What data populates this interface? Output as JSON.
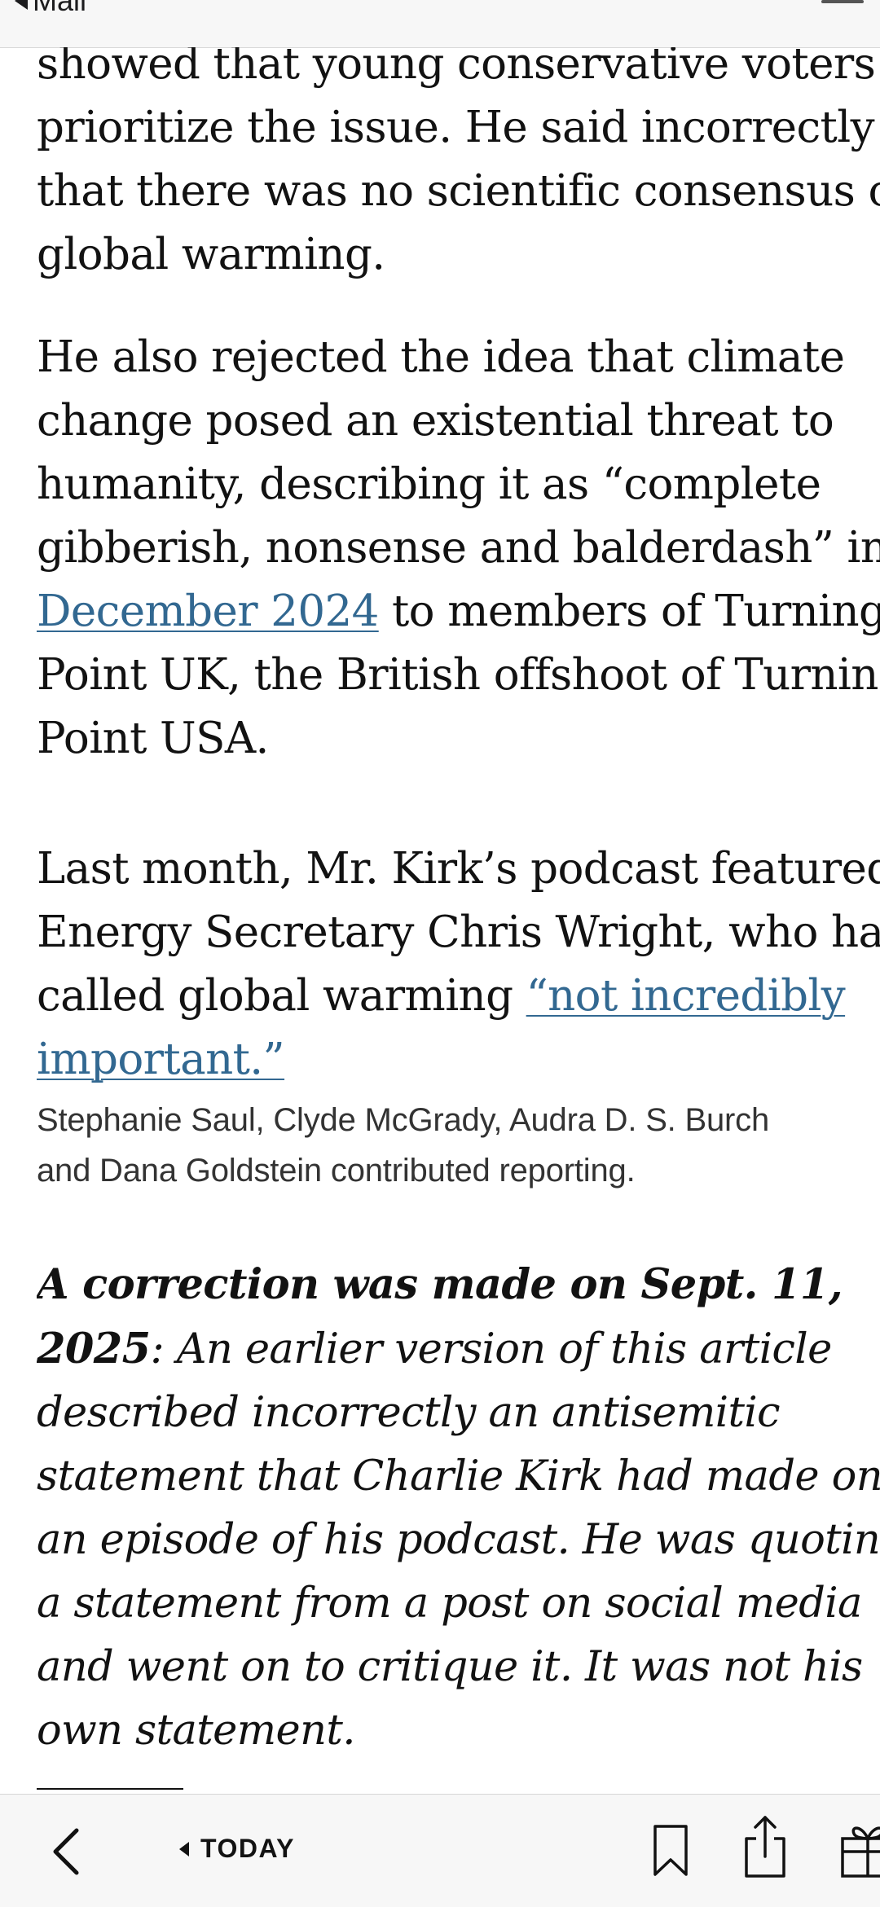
{
  "status_bar": {
    "back_app_label": "Mail"
  },
  "article": {
    "paragraph1": [
      "showed that young conservative voters",
      "prioritize the issue. He said incorrectly",
      "that there was no scientific consensus on",
      "global warming."
    ],
    "paragraph2": {
      "line1": "He also rejected the idea that climate",
      "line2": "change posed an existential threat to",
      "line3": "humanity, describing it as “complete",
      "line4": "gibberish, nonsense and balderdash” in",
      "link_text": "December 2024",
      "line5_rest": " to members of Turning",
      "line6": "Point UK, the British offshoot of Turning",
      "line7": "Point USA."
    },
    "paragraph3": {
      "line1": "Last month, Mr. Kirk’s podcast featured",
      "line2": "Energy Secretary Chris Wright, who has",
      "line3_prefix": "called global warming ",
      "link_line1": "“not incredibly",
      "link_line2": "important.”"
    },
    "credits": [
      "Stephanie Saul, Clyde McGrady, Audra D. S. Burch",
      "and Dana Goldstein contributed reporting."
    ],
    "correction": {
      "bold_lead": "A correction was made on Sept. 11,",
      "bold_date": "2025",
      "line1_rest": ": An earlier version of this article",
      "lines": [
        "described incorrectly an antisemitic",
        "statement that Charlie Kirk had made on",
        "an episode of his podcast. He was quoting",
        "a statement from a post on social media",
        "and went on to critique it. It was not his",
        "own statement."
      ]
    }
  },
  "toolbar": {
    "back_icon": "chevron-left-icon",
    "today_label": "TODAY",
    "bookmark_icon": "bookmark-icon",
    "share_icon": "share-icon",
    "gift_icon": "gift-icon"
  },
  "colors": {
    "link": "#326891",
    "text": "#121212",
    "toolbar_bg": "#f7f7f7"
  }
}
